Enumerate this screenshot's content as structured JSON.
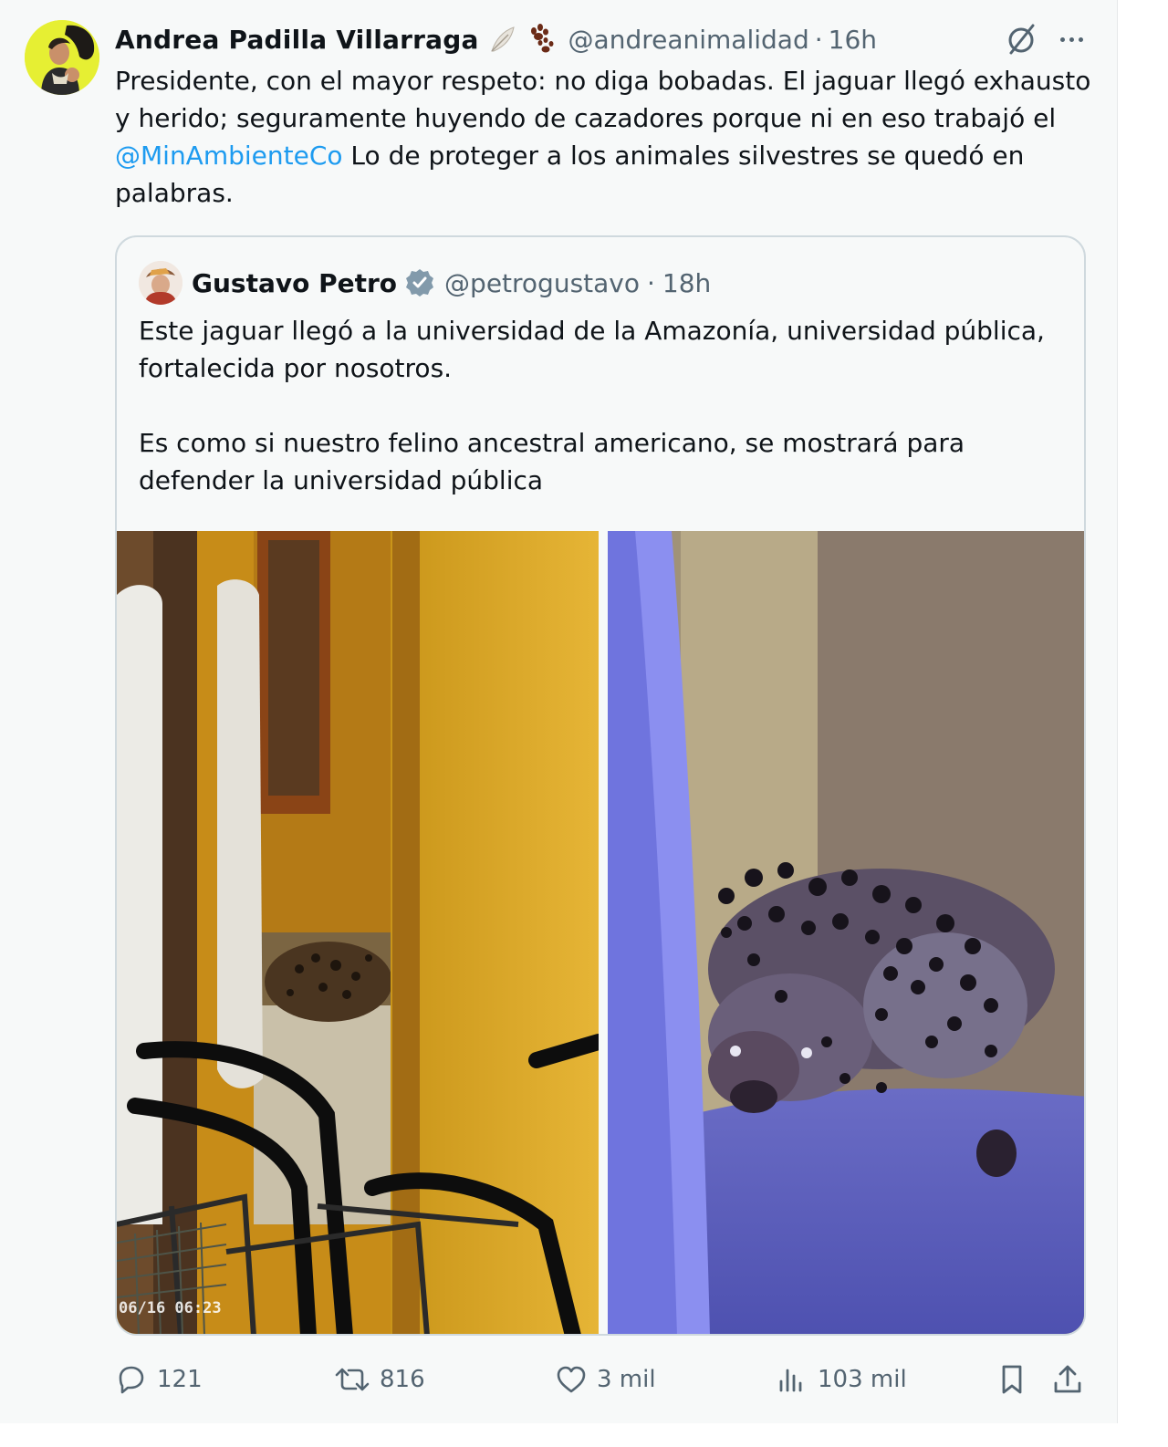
{
  "tweet": {
    "author": {
      "display_name": "Andrea Padilla Villarraga",
      "emoji": [
        "feather-emoji",
        "paw-prints-emoji"
      ],
      "handle": "@andreanimalidad",
      "separator": "·",
      "time": "16h"
    },
    "text": {
      "part1": "Presidente, con el mayor respeto: no diga bobadas. El jaguar llegó exhausto y herido; seguramente huyendo de cazadores porque ni en eso trabajó el ",
      "mention": "@MinAmbienteCo",
      "part2": " Lo de proteger a los animales silvestres se quedó en palabras."
    },
    "quoted": {
      "display_name": "Gustavo Petro",
      "verified": true,
      "handle": "@petrogustavo",
      "separator": "·",
      "time": "18h",
      "paragraph1": "Este jaguar llegó a la universidad de la Amazonía, universidad pública, fortalecida por nosotros.",
      "paragraph2": "Es como si nuestro felino ancestral americano, se mostrará para defender la universidad pública",
      "images": [
        {
          "alt": "jaguar lying in a yellow hallway behind walkers",
          "timestamp": "06/16 06:23"
        },
        {
          "alt": "close-up of jaguar resting by a wall in blue light"
        }
      ]
    },
    "actions": {
      "replies": "121",
      "reposts": "816",
      "likes": "3 mil",
      "views": "103 mil"
    }
  },
  "colors": {
    "background": "#f7f9f9",
    "text": "#0f1419",
    "secondary": "#536471",
    "link": "#1d9bf0",
    "border": "#cfd9de"
  }
}
